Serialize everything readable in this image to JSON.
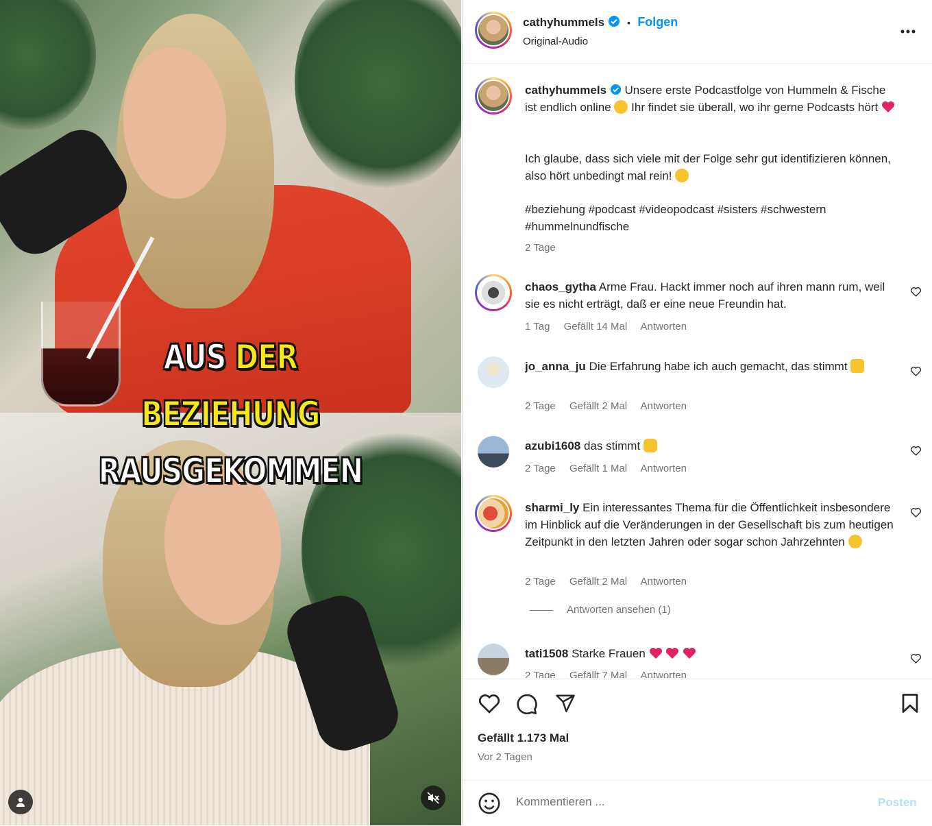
{
  "media": {
    "caption_line1_white": "AUS",
    "caption_line1_yellow": "DER",
    "caption_line2": "BEZIEHUNG",
    "caption_line3": "RAUSGEKOMMEN",
    "mute_icon": "speaker-muted-icon",
    "user_tag_icon": "person-icon"
  },
  "header": {
    "username": "cathyhummels",
    "separator": "•",
    "follow_label": "Folgen",
    "audio": "Original-Audio",
    "more_icon": "more-options-icon"
  },
  "caption": {
    "username": "cathyhummels",
    "p1_a": "Unsere erste Podcastfolge von Hummeln & Fische ist endlich online",
    "p1_b": "Ihr findet sie überall, wo ihr gerne Podcasts hört",
    "p2": "Ich glaube, dass sich viele mit der Folge sehr gut identifizieren können, also hört unbedingt mal rein!",
    "hashtags": "#beziehung #podcast #videopodcast #sisters #schwestern #hummelnundfische",
    "time": "2 Tage"
  },
  "comments": [
    {
      "user": "chaos_gytha",
      "text": "Arme Frau. Hackt immer noch auf ihren mann rum, weil sie es nicht erträgt, daß er eine neue Freundin hat.",
      "time": "1 Tag",
      "likes": "Gefällt 14 Mal",
      "reply": "Antworten"
    },
    {
      "user": "jo_anna_ju",
      "text": "Die Erfahrung habe ich auch gemacht, das stimmt",
      "time": "2 Tage",
      "likes": "Gefällt 2 Mal",
      "reply": "Antworten"
    },
    {
      "user": "azubi1608",
      "text": "das stimmt",
      "time": "2 Tage",
      "likes": "Gefällt 1 Mal",
      "reply": "Antworten"
    },
    {
      "user": "sharmi_ly",
      "text": "Ein interessantes Thema für die Öffentlichkeit insbesondere im Hinblick auf die Veränderungen in der Gesellschaft bis zum heutigen Zeitpunkt in den letzten Jahren oder sogar schon Jahrzehnten",
      "time": "2 Tage",
      "likes": "Gefällt 2 Mal",
      "reply": "Antworten",
      "view_replies": "Antworten ansehen (1)"
    },
    {
      "user": "tati1508",
      "text": "Starke Frauen",
      "time": "2 Tage",
      "likes": "Gefällt 7 Mal",
      "reply": "Antworten"
    }
  ],
  "actions": {
    "like_icon": "heart-icon",
    "comment_icon": "comment-bubble-icon",
    "share_icon": "paper-plane-icon",
    "save_icon": "bookmark-icon",
    "likes": "Gefällt 1.173 Mal",
    "posted": "Vor 2 Tagen"
  },
  "composer": {
    "placeholder": "Kommentieren ...",
    "post_label": "Posten",
    "emoji_icon": "smiley-icon"
  },
  "colors": {
    "accent": "#0095f6",
    "verified": "#0095f6",
    "caption_yellow": "#f6e81c",
    "heart_red": "#e0245e"
  }
}
